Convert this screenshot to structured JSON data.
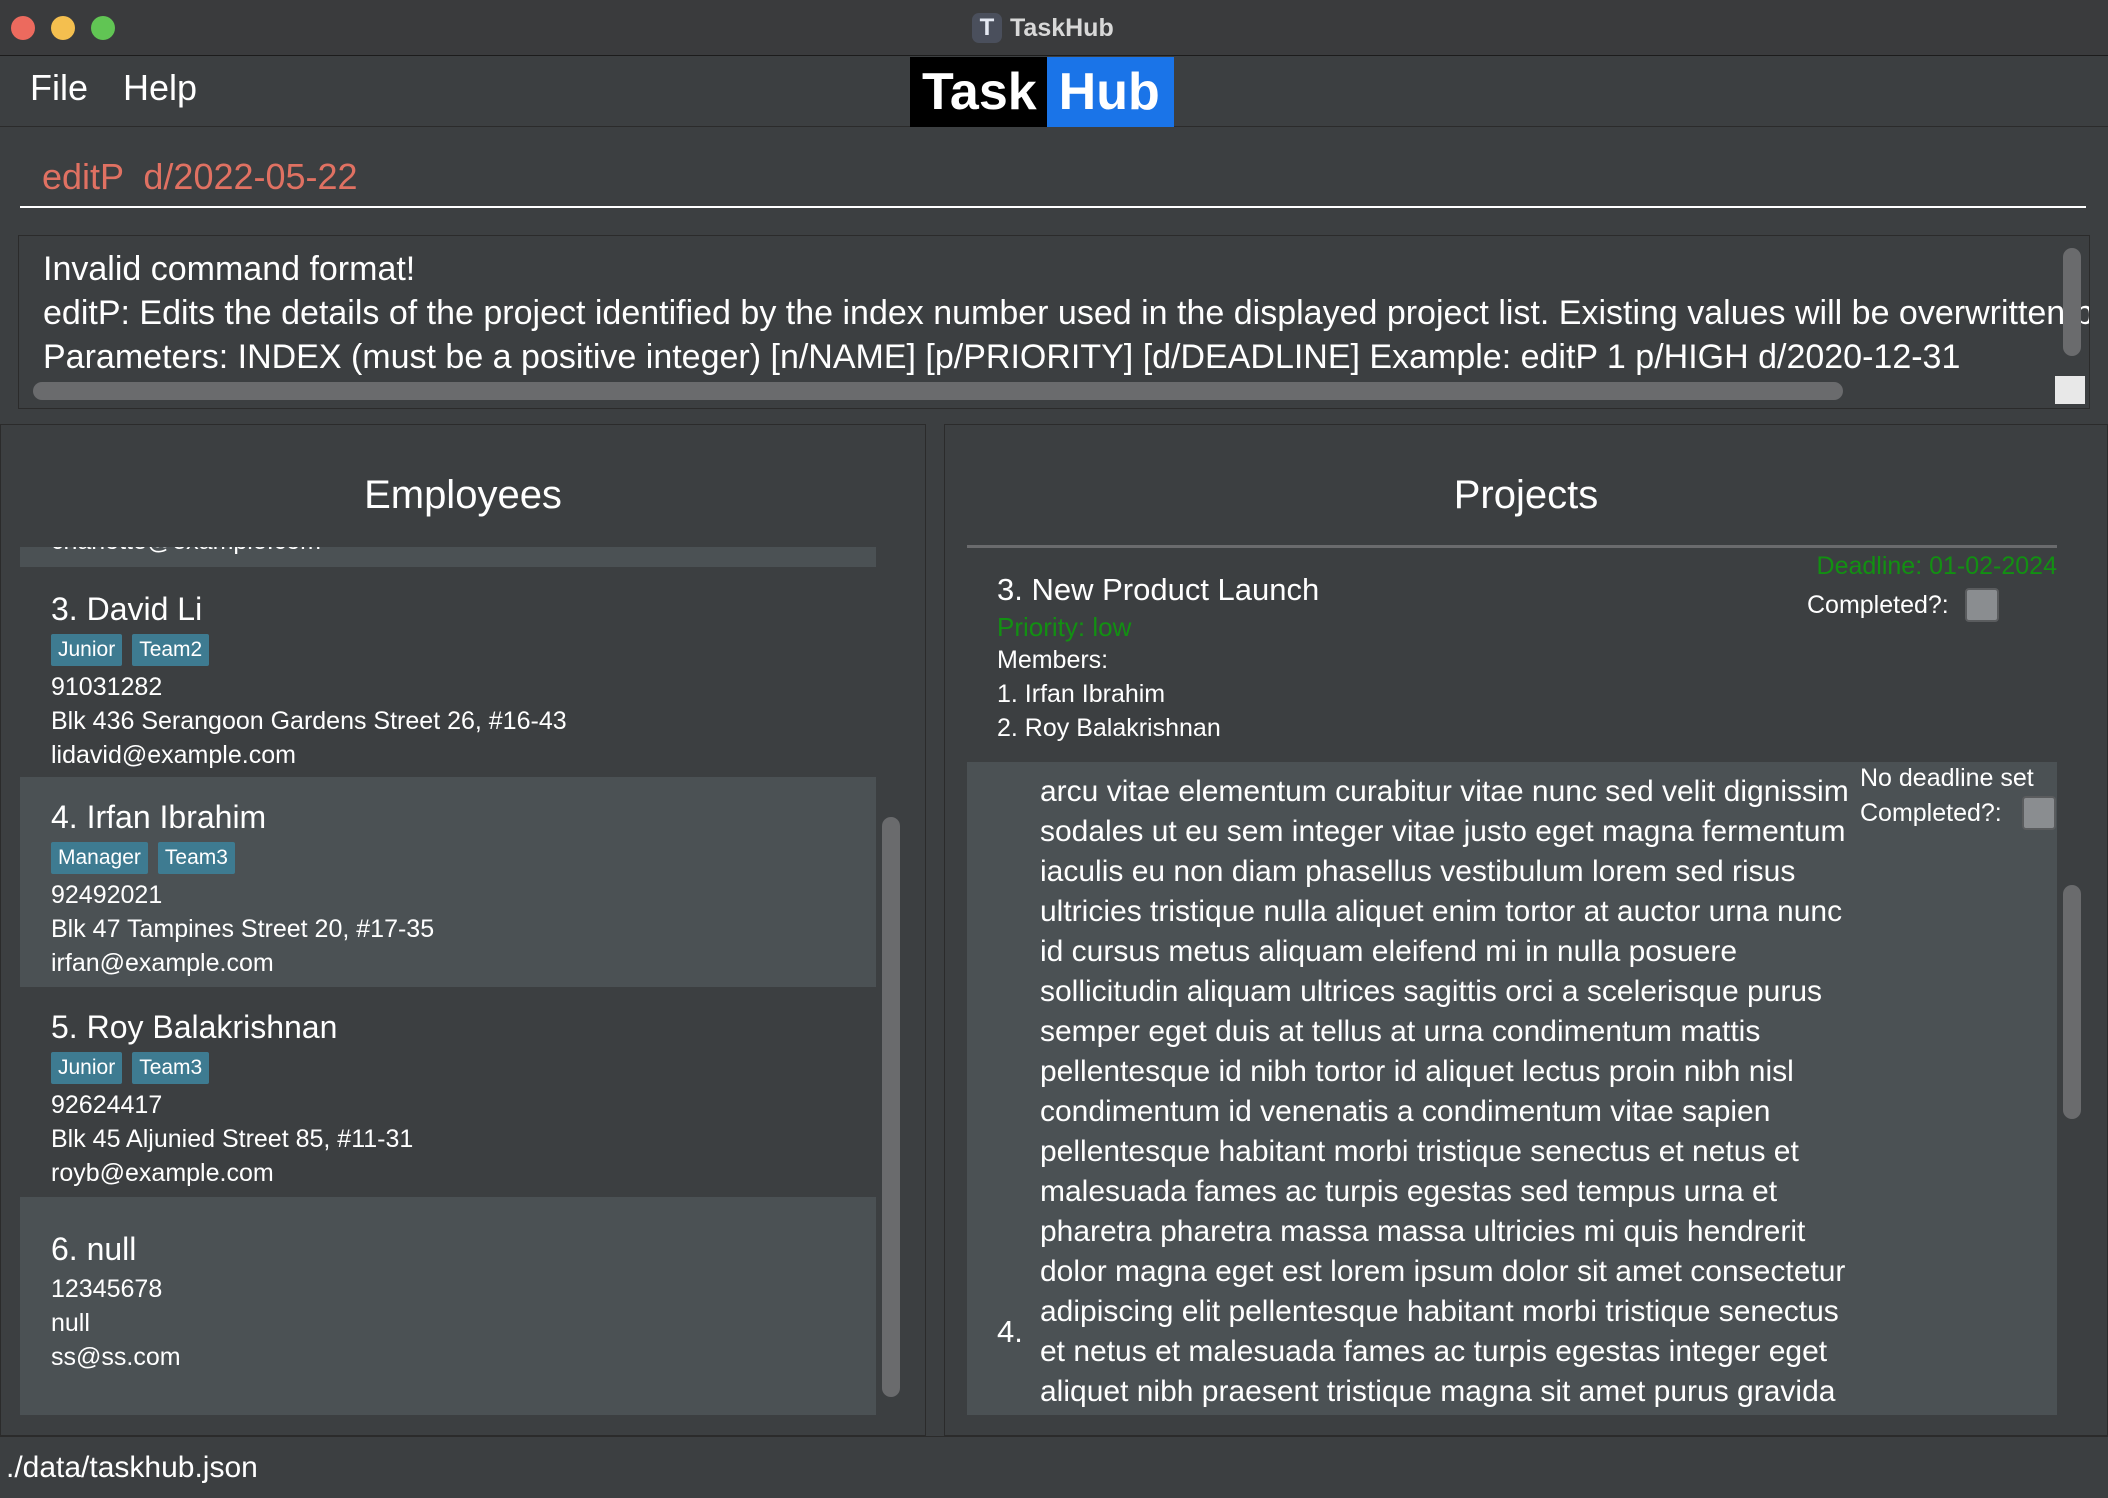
{
  "window": {
    "title": "TaskHub",
    "icon_letter": "T"
  },
  "menu": {
    "file": "File",
    "help": "Help"
  },
  "logo": {
    "task": "Task",
    "hub": "Hub"
  },
  "command": {
    "value": "editP  d/2022-05-22"
  },
  "result": {
    "line1": "Invalid command format!",
    "line2": "editP: Edits the details of the project identified by the index number used in the displayed project list. Existing values will be overwritten by the",
    "line3": "Parameters: INDEX (must be a positive integer) [n/NAME] [p/PRIORITY] [d/DEADLINE] Example: editP 1 p/HIGH d/2020-12-31"
  },
  "employees": {
    "title": "Employees",
    "partial_email": "charlotte@example.com",
    "items": [
      {
        "name": "3.  David Li",
        "tags": [
          "Junior",
          "Team2"
        ],
        "phone": "91031282",
        "address": "Blk 436 Serangoon Gardens Street 26, #16-43",
        "email": "lidavid@example.com"
      },
      {
        "name": "4.  Irfan Ibrahim",
        "tags": [
          "Manager",
          "Team3"
        ],
        "phone": "92492021",
        "address": "Blk 47 Tampines Street 20, #17-35",
        "email": "irfan@example.com"
      },
      {
        "name": "5.  Roy Balakrishnan",
        "tags": [
          "Junior",
          "Team3"
        ],
        "phone": "92624417",
        "address": "Blk 45 Aljunied Street 85, #11-31",
        "email": "royb@example.com"
      },
      {
        "name": "6.  null",
        "phone": "12345678",
        "address": "null",
        "email": "ss@ss.com"
      }
    ]
  },
  "projects": {
    "title": "Projects",
    "items": [
      {
        "name": "3.  New Product Launch",
        "priority": "Priority: low",
        "deadline": "Deadline: 01-02-2024",
        "completed_label": "Completed?:",
        "members_label": "Members:",
        "members": [
          "1. Irfan Ibrahim",
          "2. Roy Balakrishnan"
        ]
      },
      {
        "index": "4.",
        "name": "arcu vitae elementum curabitur vitae nunc sed velit dignissim sodales ut eu sem integer vitae justo eget magna fermentum iaculis eu non diam phasellus vestibulum lorem sed risus ultricies tristique nulla aliquet enim tortor at auctor urna nunc id cursus metus aliquam eleifend mi in nulla posuere sollicitudin aliquam ultrices sagittis orci a scelerisque purus semper eget duis at tellus at urna condimentum mattis pellentesque id nibh tortor id aliquet lectus proin nibh nisl condimentum id venenatis a condimentum vitae sapien pellentesque habitant morbi tristique senectus et netus et malesuada fames ac turpis egestas sed tempus urna et pharetra pharetra massa massa ultricies mi quis hendrerit dolor magna eget est lorem ipsum dolor sit amet consectetur adipiscing elit pellentesque habitant morbi tristique senectus et netus et malesuada fames ac turpis egestas integer eget aliquet nibh praesent tristique magna sit amet purus gravida",
        "deadline": "No deadline set",
        "completed_label": "Completed?:"
      }
    ]
  },
  "status": {
    "path": "./data/taskhub.json"
  },
  "colors": {
    "background": "#3c3f41",
    "card_alt": "#4b5154",
    "tag": "#3e7b91",
    "command_text": "#e07162",
    "priority_green": "#129012",
    "logo_blue": "#1a74e8"
  }
}
